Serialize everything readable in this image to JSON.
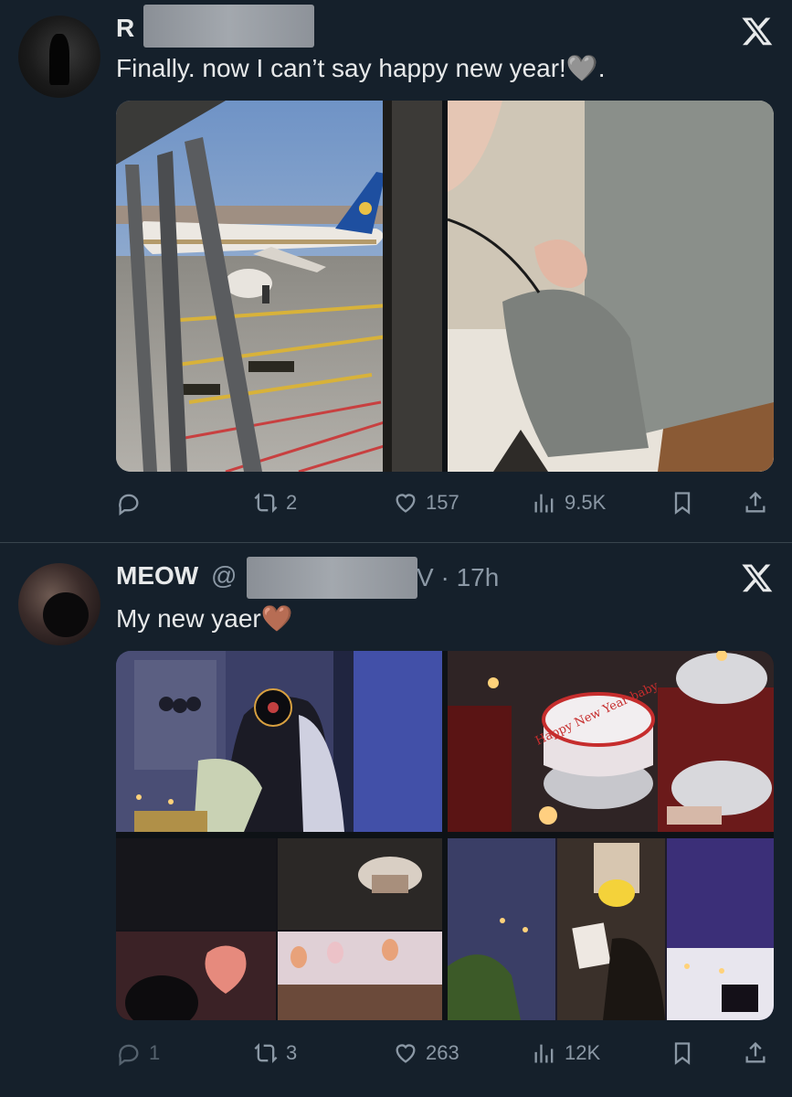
{
  "tweets": [
    {
      "name": "R",
      "text": "Finally. now I can’t say happy new year!🩶.",
      "media_count": 2,
      "stats": {
        "replies": "",
        "retweets": "2",
        "likes": "157",
        "views": "9.5K"
      },
      "icons": [
        "reply-icon",
        "retweet-icon",
        "like-icon",
        "views-icon",
        "bookmark-icon",
        "share-icon",
        "x-logo-icon"
      ]
    },
    {
      "name": "MEOW",
      "handle_prefix": "@",
      "handle_suffix": "V",
      "time": "· 17h",
      "text": "My new yaer🤎",
      "cake_text": "Happy New Year baby",
      "media_count": 4,
      "stats": {
        "replies": "1",
        "retweets": "3",
        "likes": "263",
        "views": "12K"
      },
      "icons": [
        "reply-icon",
        "retweet-icon",
        "like-icon",
        "views-icon",
        "bookmark-icon",
        "share-icon",
        "x-logo-icon"
      ]
    }
  ],
  "colors": {
    "background": "#15202b",
    "text": "#e7e9ea",
    "secondary": "#8b98a5",
    "divider": "#38444d"
  }
}
